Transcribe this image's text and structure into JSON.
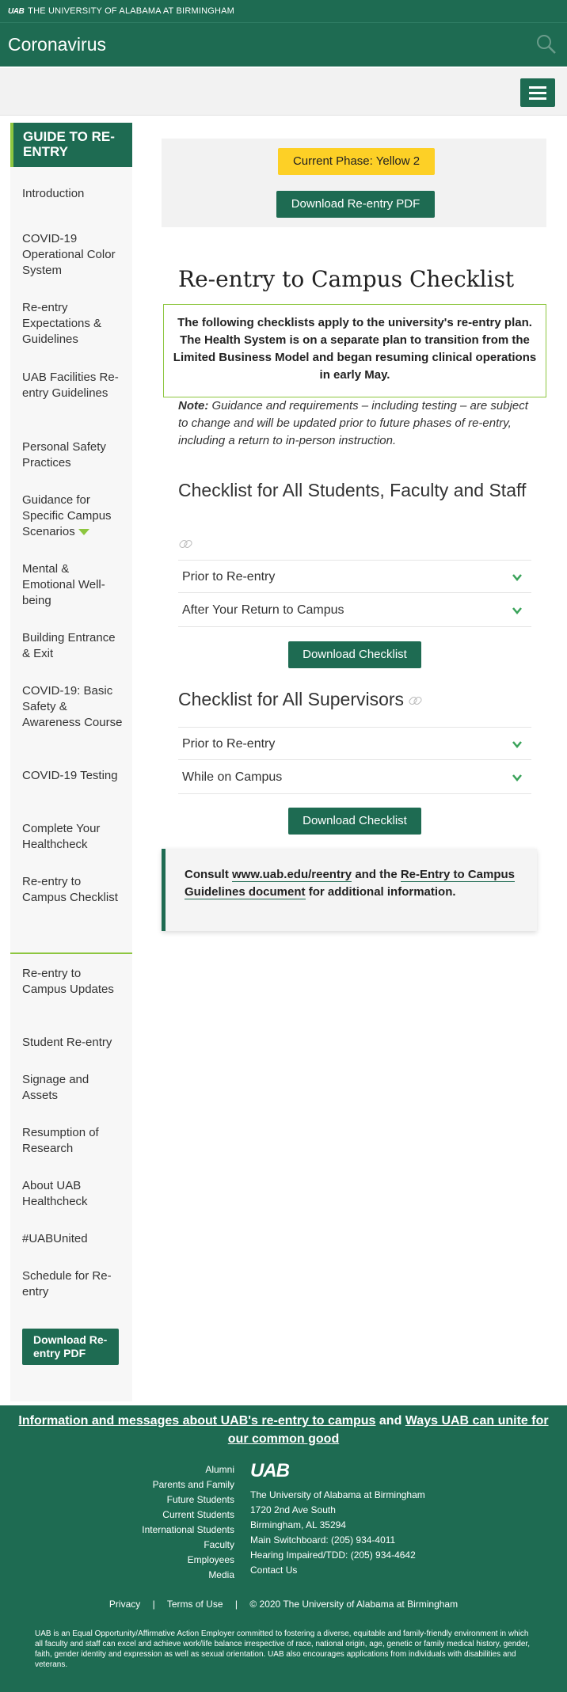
{
  "topbar": {
    "logo": "UAB",
    "university": "THE UNIVERSITY OF ALABAMA AT BIRMINGHAM"
  },
  "site": {
    "title": "Coronavirus",
    "search_icon": "search-icon",
    "menu_icon": "hamburger-menu-icon"
  },
  "sidebar": {
    "heading": "GUIDE TO RE-ENTRY",
    "items": [
      "Introduction",
      "COVID-19 Operational Color System",
      "Re-entry Expectations & Guidelines",
      "UAB Facilities Re-entry Guidelines",
      "Personal Safety Practices",
      "Guidance for Specific Campus Scenarios",
      "Mental & Emotional Well-being",
      "Building Entrance & Exit",
      "COVID-19: Basic Safety & Awareness Course",
      "COVID-19 Testing",
      "Complete Your Healthcheck",
      "Re-entry to Campus Checklist",
      "Re-entry to Campus Updates",
      "Student Re-entry",
      "Signage and Assets",
      "Resumption of Research",
      "About UAB Healthcheck",
      "#UABUnited",
      "Schedule for Re-entry"
    ],
    "download_label": "Download Re-entry PDF"
  },
  "phase": {
    "current": "Current Phase: Yellow 2",
    "download_label": "Download Re-entry PDF"
  },
  "main": {
    "title": "Re-entry to Campus Checklist",
    "intro": "The following checklists apply to the university's re-entry plan. The Health System is on a separate plan to transition from the Limited Business Model and began resuming clinical operations in early May.",
    "note_label": "Note:",
    "note_text": "Guidance and requirements – including testing – are subject to change and will be updated prior to future phases of re-entry, including a return to in-person instruction.",
    "section1": {
      "title": "Checklist for All Students, Faculty and Staff",
      "rows": [
        "Prior to Re-entry",
        "After Your Return to Campus"
      ],
      "download_label": "Download Checklist"
    },
    "section2": {
      "title": "Checklist for All Supervisors",
      "rows": [
        "Prior to Re-entry",
        "While on Campus"
      ],
      "download_label": "Download Checklist"
    },
    "consult": {
      "prefix": "Consult",
      "link1": "www.uab.edu/reentry",
      "middle": "and the",
      "link2": "Re-Entry to Campus Guidelines document",
      "suffix": "for additional information."
    }
  },
  "banner": {
    "link1": "Information and messages about UAB's re-entry to campus",
    "middle": "and",
    "link2": "Ways UAB can unite for our common good"
  },
  "footer": {
    "audience": [
      "Alumni",
      "Parents and Family",
      "Future Students",
      "Current Students",
      "International Students",
      "Faculty",
      "Employees",
      "Media"
    ],
    "logo": "UAB",
    "address": [
      "The University of Alabama at Birmingham",
      "1720 2nd Ave South",
      "Birmingham, AL 35294",
      "Main Switchboard: (205) 934-4011",
      "Hearing Impaired/TDD: (205) 934-4642",
      "Contact Us"
    ],
    "legal": [
      "Privacy",
      "Terms of Use",
      "© 2020 The University of Alabama at Birmingham"
    ],
    "separator": "|",
    "eeo": "UAB is an Equal Opportunity/Affirmative Action Employer committed to fostering a diverse, equitable and family-friendly environment in which all faculty and staff can excel and achieve work/life balance irrespective of race, national origin, age, genetic or family medical history, gender, faith, gender identity and expression as well as sexual orientation. UAB also encourages applications from individuals with disabilities and veterans."
  },
  "colors": {
    "brand_green": "#1e6b52",
    "accent_green": "#8dc63f",
    "phase_yellow": "#fdd026"
  }
}
